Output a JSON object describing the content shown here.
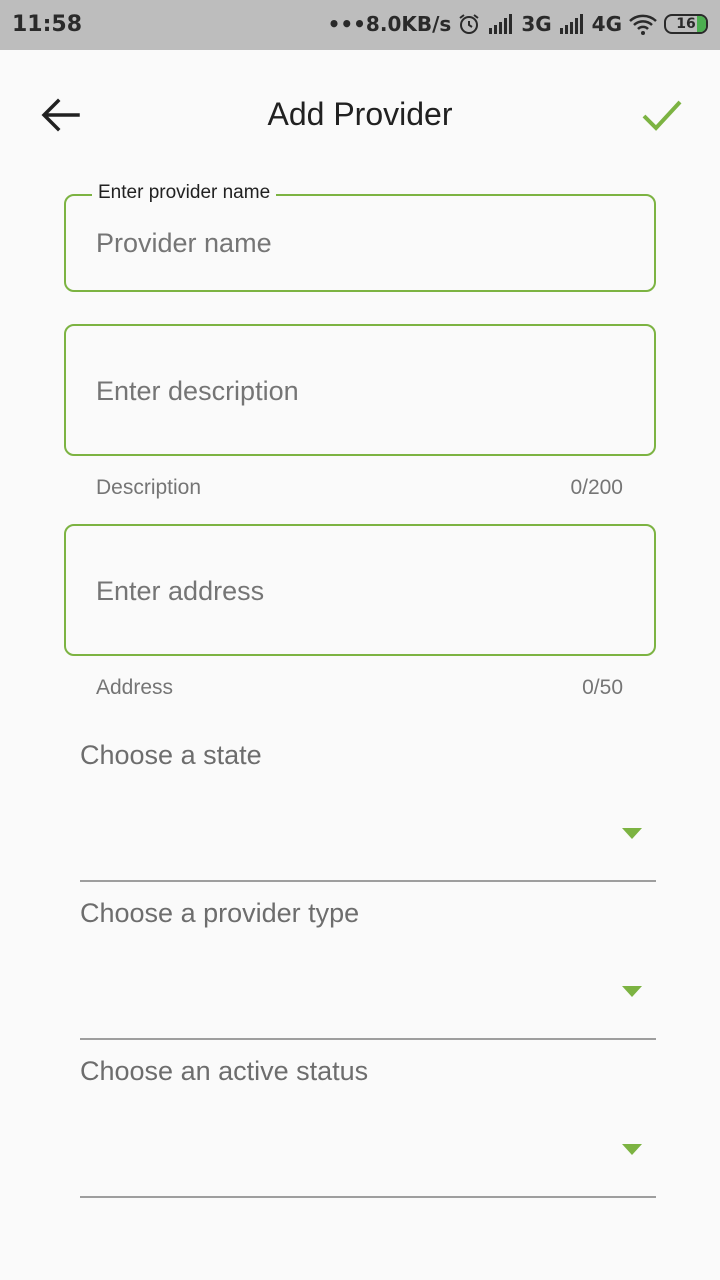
{
  "status_bar": {
    "time": "11:58",
    "network_speed": "•••8.0KB/s",
    "network_3g": "3G",
    "network_4g": "4G",
    "battery_level": "16"
  },
  "toolbar": {
    "title": "Add Provider",
    "back_icon": "arrow-left-icon",
    "save_icon": "check-icon"
  },
  "form": {
    "provider_name": {
      "label": "Enter provider name",
      "placeholder": "Provider name"
    },
    "description": {
      "placeholder": "Enter description",
      "helper": "Description",
      "counter": "0/200"
    },
    "address": {
      "placeholder": "Enter address",
      "helper": "Address",
      "counter": "0/50"
    },
    "state": {
      "label": "Choose a state"
    },
    "provider_type": {
      "label": "Choose a provider type"
    },
    "active_status": {
      "label": "Choose an active status"
    }
  },
  "colors": {
    "accent": "#7cb342",
    "status_bar_bg": "#bdbdbd",
    "background": "#fafafa"
  }
}
